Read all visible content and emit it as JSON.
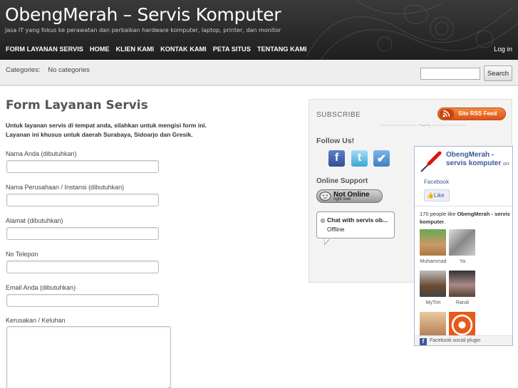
{
  "header": {
    "site_title": "ObengMerah – Servis Komputer",
    "tagline": "Jasa IT yang fokus ke perawatan dan perbaikan hardware komputer, laptop, printer, dan monitor",
    "nav": [
      "FORM LAYANAN SERVIS",
      "HOME",
      "KLIEN KAMI",
      "KONTAK KAMI",
      "PETA SITUS",
      "TENTANG KAMI"
    ],
    "login_label": "Log in"
  },
  "catbar": {
    "categories_label": "Categories:",
    "categories_value": "No categories",
    "search_button": "Search",
    "search_value": ""
  },
  "main": {
    "title": "Form Layanan Servis",
    "intro_line1": "Untuk layanan servis di tempat anda, silahkan untuk mengisi form ini.",
    "intro_line2": "Layanan ini khusus untuk daerah Surabaya, Sidoarjo dan Gresik.",
    "fields": [
      {
        "label": "Nama Anda (dibutuhkan)",
        "value": ""
      },
      {
        "label": "Nama Perusahaan / Instansi (dibutuhkan)",
        "value": ""
      },
      {
        "label": "Alamat (dibutuhkan)",
        "value": ""
      },
      {
        "label": "No Telepon",
        "value": ""
      },
      {
        "label": "Email Anda (dibutuhkan)",
        "value": ""
      }
    ],
    "complaint_label": "Kerusakan / Keluhan",
    "complaint_value": ""
  },
  "sidebar": {
    "subscribe_label": "SUBSCRIBE",
    "rss_button": "Site RSS Feed",
    "follow_label": "Follow Us!",
    "social_icons": [
      "facebook-icon",
      "twitter-icon",
      "checkmark-icon"
    ],
    "support_label": "Online Support",
    "status_title": "Not Online",
    "status_sub": "right now",
    "chat_name": "Chat with servis ob...",
    "chat_status": "Offline"
  },
  "facebook": {
    "page_name": "ObengMerah - servis komputer",
    "on_text": "on",
    "facebook_label": "Facebook",
    "like_label": "Like",
    "likes_prefix": "170 people like",
    "likes_page": "ObengMerah - servis komputer",
    "likes_suffix": ".",
    "fans": [
      "Muhammad",
      "Ya",
      "MyTim",
      "Randi",
      "",
      ""
    ],
    "footer": "Facebook social plugin",
    "brand_color": "#3b5998"
  },
  "colors": {
    "header_bg": "#2b2b2b",
    "rss_orange": "#e4682a",
    "accent_red": "#cc1111"
  }
}
